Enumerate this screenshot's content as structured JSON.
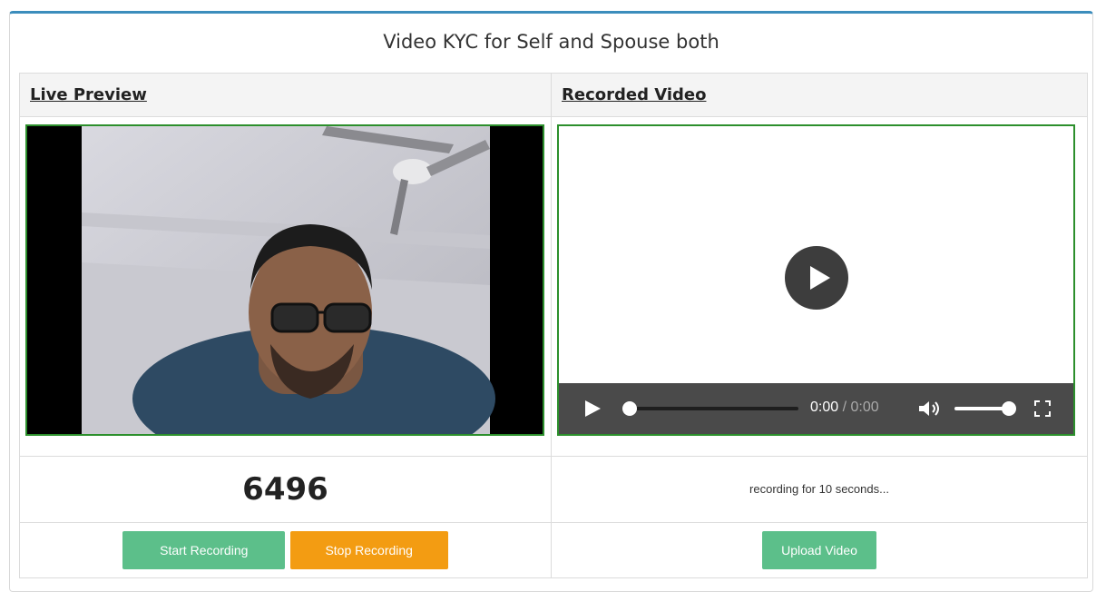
{
  "title": "Video KYC for Self and Spouse both",
  "live_preview": {
    "header": "Live Preview",
    "counter": "6496",
    "start_label": "Start Recording",
    "stop_label": "Stop Recording"
  },
  "recorded_video": {
    "header": "Recorded Video",
    "status": "recording for 10 seconds...",
    "upload_label": "Upload Video",
    "player": {
      "current_time": "0:00",
      "separator": "/",
      "duration": "0:00",
      "progress": 0,
      "volume": 1.0
    }
  },
  "colors": {
    "frame_border": "#2c8f2c",
    "button_green": "#5cbf8a",
    "button_orange": "#f39c12",
    "panel_accent": "#3c8dbc"
  }
}
